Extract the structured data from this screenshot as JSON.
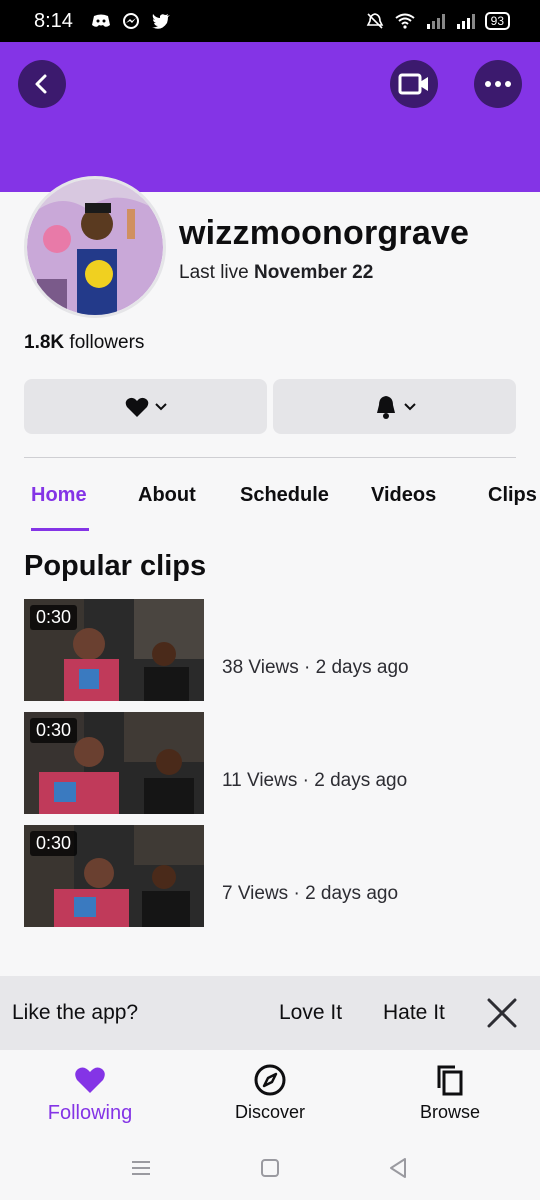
{
  "status_bar": {
    "time": "8:14",
    "battery": "93"
  },
  "header": {
    "back_icon": "chevron-left-icon",
    "video_icon": "video-camera-icon",
    "more_icon": "more-horizontal-icon",
    "color": "#8434e6"
  },
  "profile": {
    "username": "wizzmoonorgrave",
    "last_live_prefix": "Last live ",
    "last_live_date": "November 22",
    "followers_count": "1.8K",
    "followers_label": " followers"
  },
  "tabs": [
    {
      "label": "Home",
      "active": true
    },
    {
      "label": "About"
    },
    {
      "label": "Schedule"
    },
    {
      "label": "Videos"
    },
    {
      "label": "Clips"
    }
  ],
  "popular_clips": {
    "title": "Popular clips",
    "items": [
      {
        "duration": "0:30",
        "meta": "38 Views · 2 days ago"
      },
      {
        "duration": "0:30",
        "meta": "11 Views · 2 days ago"
      },
      {
        "duration": "0:30",
        "meta": "7 Views · 2 days ago"
      }
    ]
  },
  "rating_prompt": {
    "question": "Like the app?",
    "love": "Love It",
    "hate": "Hate It"
  },
  "bottom_nav": [
    {
      "label": "Following",
      "icon": "heart-icon",
      "active": true
    },
    {
      "label": "Discover",
      "icon": "compass-icon"
    },
    {
      "label": "Browse",
      "icon": "browse-icon"
    }
  ],
  "accent_color": "#8434e6"
}
